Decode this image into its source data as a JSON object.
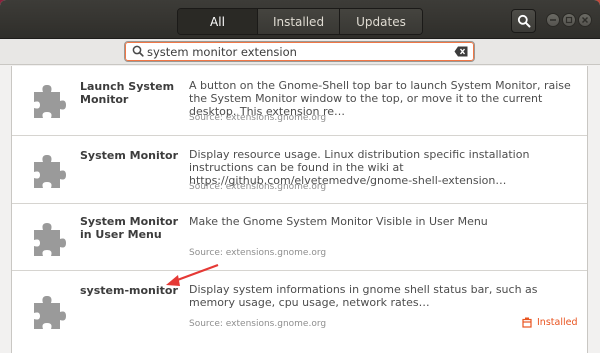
{
  "header": {
    "tabs": [
      {
        "label": "All",
        "active": true
      },
      {
        "label": "Installed",
        "active": false
      },
      {
        "label": "Updates",
        "active": false
      }
    ],
    "search_icon": "search-icon",
    "window_controls": [
      "minimize-icon",
      "maximize-icon",
      "close-icon"
    ]
  },
  "search": {
    "value": "system monitor extension",
    "placeholder": ""
  },
  "results": [
    {
      "name": "Launch System Monitor",
      "description": "A button on the Gnome-Shell top bar to launch System Monitor, raise the System Monitor window to the top, or move it to the current desktop. This extension re…",
      "source": "Source: extensions.gnome.org",
      "installed": ""
    },
    {
      "name": "System Monitor",
      "description": "Display resource usage.  Linux distribution specific installation instructions can be found in the wiki at https://github.com/elvetemedve/gnome-shell-extension…",
      "source": "Source: extensions.gnome.org",
      "installed": ""
    },
    {
      "name": "System Monitor in User Menu",
      "description": "Make the Gnome System Monitor Visible in User Menu",
      "source": "Source: extensions.gnome.org",
      "installed": ""
    },
    {
      "name": "system-monitor",
      "description": "Display system informations in gnome shell status bar, such as memory usage, cpu usage, network rates…",
      "source": "Source: extensions.gnome.org",
      "installed": "Installed"
    }
  ],
  "colors": {
    "accent": "#e95420",
    "annotation_arrow": "#e53935",
    "puzzle_icon": "#9a9a9a"
  }
}
